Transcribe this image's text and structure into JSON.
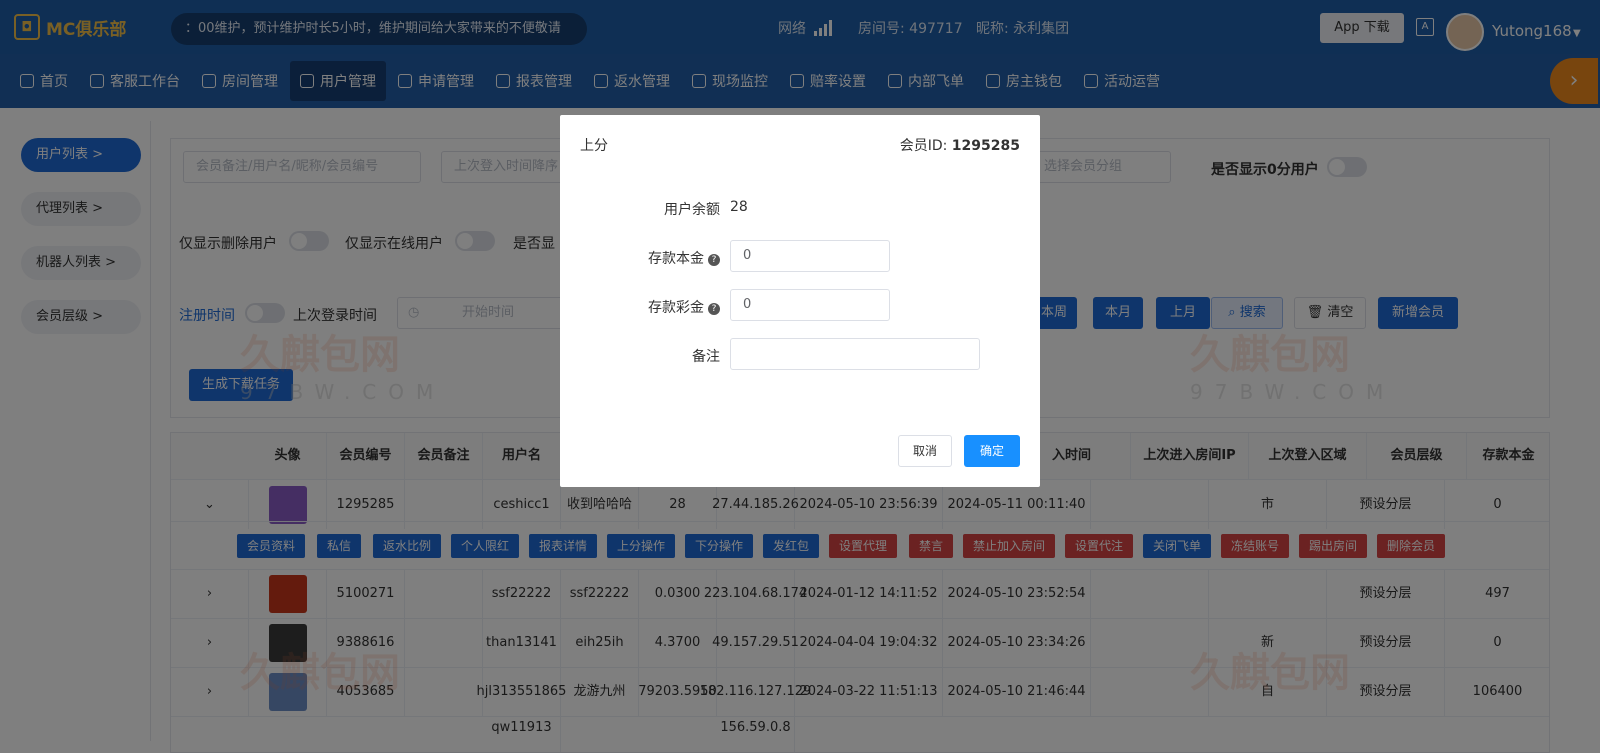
{
  "header": {
    "logo": "MC俱乐部",
    "notice": "：00维护，预计维护时长5小时，维护期间给大家带来的不便敬请",
    "network_label": "网络",
    "room": "房间号: 497717",
    "nickname": "昵称: 永利集团",
    "app_download": "App 下载",
    "username": "Yutong168"
  },
  "nav": [
    {
      "label": "首页",
      "icon": "home-icon"
    },
    {
      "label": "客服工作台",
      "icon": "headset-icon"
    },
    {
      "label": "房间管理",
      "icon": "grid-icon"
    },
    {
      "label": "用户管理",
      "icon": "user-icon",
      "active": true
    },
    {
      "label": "申请管理",
      "icon": "document-icon"
    },
    {
      "label": "报表管理",
      "icon": "bar-chart-icon"
    },
    {
      "label": "返水管理",
      "icon": "tag-icon"
    },
    {
      "label": "现场监控",
      "icon": "monitor-icon"
    },
    {
      "label": "赔率设置",
      "icon": "shield-icon"
    },
    {
      "label": "内部飞单",
      "icon": "refresh-icon"
    },
    {
      "label": "房主钱包",
      "icon": "wallet-icon"
    },
    {
      "label": "活动运营",
      "icon": "gift-icon"
    }
  ],
  "sidebar": [
    {
      "label": "用户列表 >",
      "active": true
    },
    {
      "label": "代理列表 >"
    },
    {
      "label": "机器人列表 >"
    },
    {
      "label": "会员层级 >"
    }
  ],
  "filters": {
    "search_placeholder": "会员备注/用户名/昵称/会员编号",
    "sort_placeholder": "上次登入时间降序",
    "group_placeholder": "选择会员分组",
    "show_zero": "是否显示0分用户",
    "only_deleted": "仅显示删除用户",
    "only_online": "仅显示在线用户",
    "show_partial": "是否显",
    "reg_time": "注册时间",
    "last_login": "上次登录时间",
    "start_time": "开始时间",
    "btn_week": "本周",
    "btn_month": "本月",
    "btn_last_month": "上月",
    "btn_search": "搜索",
    "btn_clear": "清空",
    "btn_add": "新增会员",
    "btn_generate": "生成下载任务"
  },
  "table": {
    "headers": [
      "头像",
      "会员编号",
      "会员备注",
      "用户名",
      "入时间",
      "上次进入房间IP",
      "上次登入区域",
      "会员层级",
      "存款本金"
    ],
    "rows": [
      {
        "id": "1295285",
        "remark": "",
        "username": "ceshicc1",
        "nickname": "收到哈哈哈",
        "balance": "28",
        "ip": "27.44.185.26",
        "reg": "2024-05-10 23:56:39",
        "login": "2024-05-11 00:11:40",
        "region": "市",
        "level": "预设分层",
        "deposit": "0"
      },
      {
        "id": "5100271",
        "remark": "",
        "username": "ssf22222",
        "nickname": "ssf22222",
        "balance": "0.0300",
        "ip": "223.104.68.174",
        "reg": "2024-01-12 14:11:52",
        "login": "2024-05-10 23:52:54",
        "region": "",
        "level": "预设分层",
        "deposit": "497"
      },
      {
        "id": "9388616",
        "remark": "",
        "username": "than13141",
        "nickname": "eih25ih",
        "balance": "4.3700",
        "ip": "49.157.29.51",
        "reg": "2024-04-04 19:04:32",
        "login": "2024-05-10 23:34:26",
        "region": "新",
        "level": "预设分层",
        "deposit": "0"
      },
      {
        "id": "4053685",
        "remark": "",
        "username": "hjl313551865",
        "nickname": "龙游九州",
        "balance": "79203.5950",
        "ip": "182.116.127.129",
        "reg": "2024-03-22 11:51:13",
        "login": "2024-05-10 21:46:44",
        "region": "自",
        "level": "预设分层",
        "deposit": "106400"
      }
    ],
    "partial_row": {
      "username": "qw11913",
      "ip": "156.59.0.8"
    },
    "actions": [
      {
        "label": "会员资料",
        "c": "b"
      },
      {
        "label": "私信",
        "c": "b"
      },
      {
        "label": "返水比例",
        "c": "b"
      },
      {
        "label": "个人限红",
        "c": "b"
      },
      {
        "label": "报表详情",
        "c": "b"
      },
      {
        "label": "上分操作",
        "c": "b"
      },
      {
        "label": "下分操作",
        "c": "b"
      },
      {
        "label": "发红包",
        "c": "b"
      },
      {
        "label": "设置代理",
        "c": "r"
      },
      {
        "label": "禁言",
        "c": "r"
      },
      {
        "label": "禁止加入房间",
        "c": "r"
      },
      {
        "label": "设置代注",
        "c": "r"
      },
      {
        "label": "关闭飞单",
        "c": "b"
      },
      {
        "label": "冻结账号",
        "c": "r"
      },
      {
        "label": "踢出房间",
        "c": "r"
      },
      {
        "label": "删除会员",
        "c": "r"
      }
    ]
  },
  "modal": {
    "title": "上分",
    "member_id_label": "会员ID:",
    "member_id": "1295285",
    "balance_label": "用户余额",
    "balance": "28",
    "deposit_label": "存款本金",
    "deposit_value": "0",
    "bonus_label": "存款彩金",
    "bonus_value": "0",
    "note_label": "备注",
    "note_value": "",
    "cancel": "取消",
    "confirm": "确定"
  },
  "watermark": {
    "text": "久麒包网",
    "sub": "97BW.COM"
  },
  "colors": {
    "header": "#1e5fa8",
    "primary": "#1e6ad6",
    "danger": "#d64545",
    "accent": "#f08a1c",
    "confirm": "#1890ff"
  }
}
